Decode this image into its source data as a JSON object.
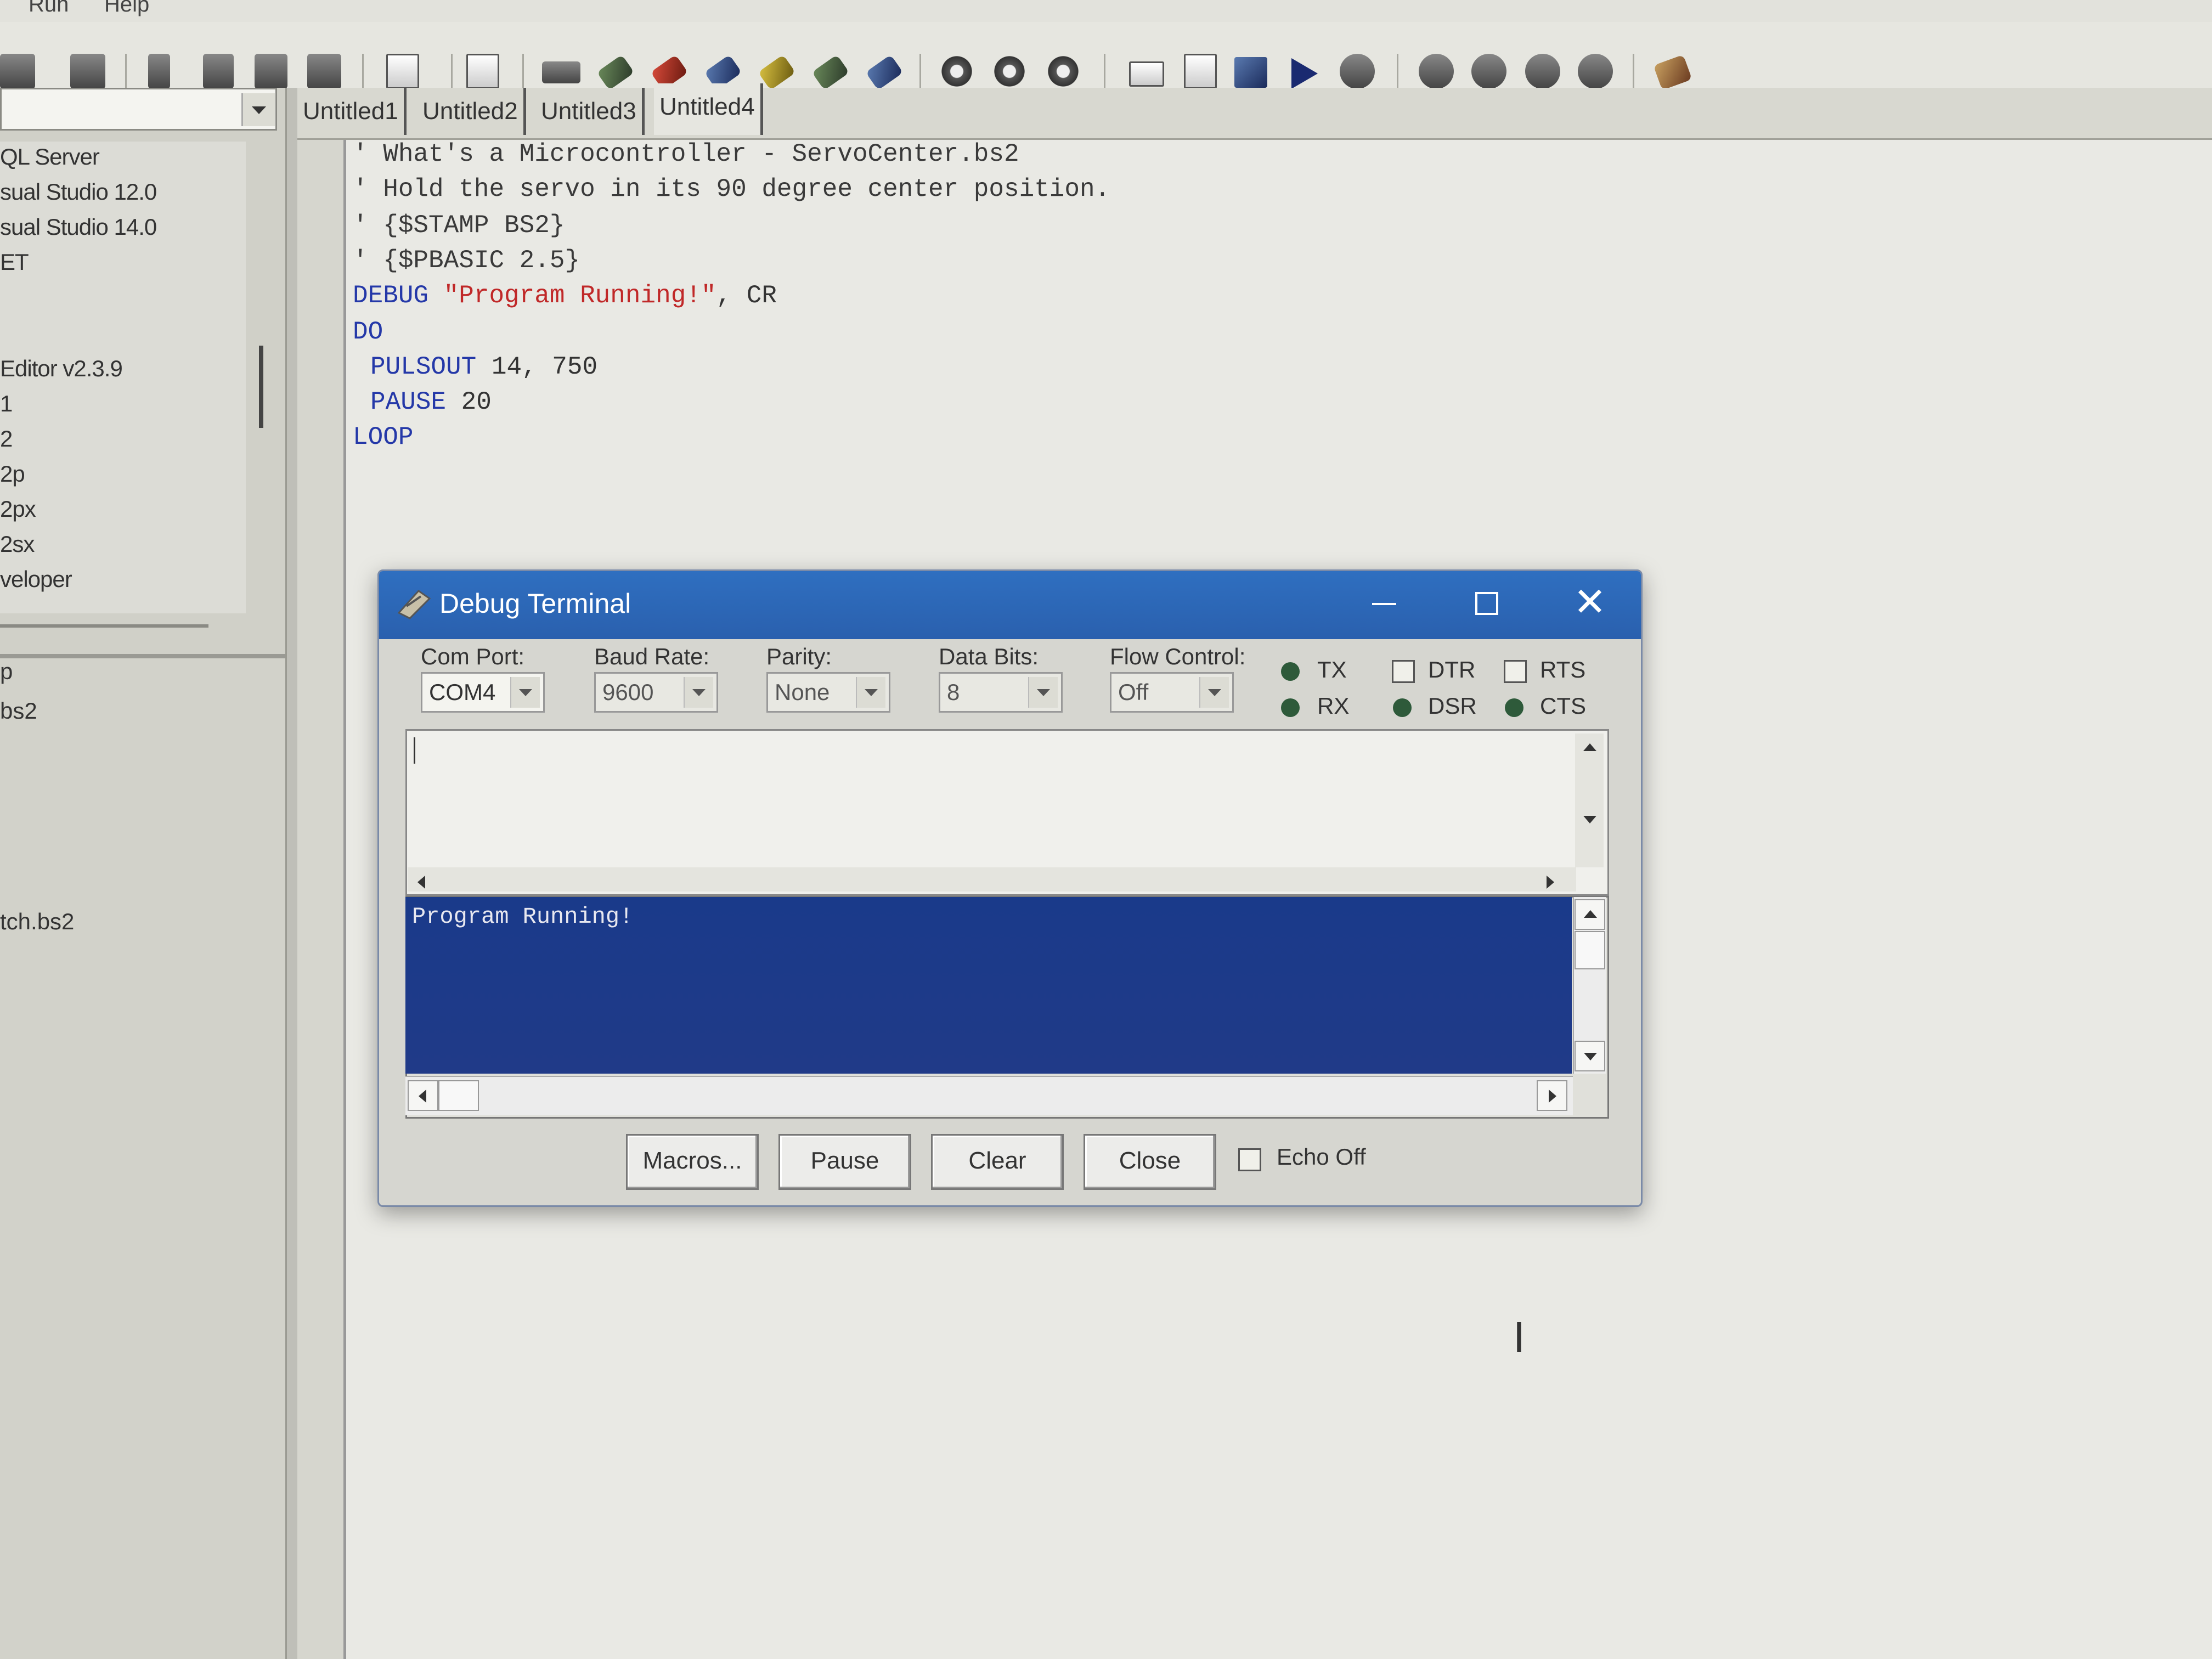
{
  "menu": {
    "items": [
      "Run",
      "Help"
    ]
  },
  "toolbar": {
    "icons": [
      "find-icon",
      "print-icon",
      "cut-icon",
      "copy-icon",
      "paste-icon",
      "binoculars-icon",
      "format-icon",
      "preferences-icon",
      "chip-bs1-icon",
      "chip-bs2-icon",
      "chip-bs2e-icon",
      "chip-bs2sx-icon",
      "chip-bs2p-icon",
      "chip-bs2pe-icon",
      "chip-bs2px-icon",
      "pbasic-1-0-icon",
      "pbasic-2-0-icon",
      "pbasic-2-5-icon",
      "memory-map-icon",
      "check-syntax-icon",
      "run-icon",
      "play-icon",
      "identify-icon",
      "debug-icon",
      "debug-terminal-icon",
      "help-icon",
      "stamp-icon"
    ]
  },
  "explorer": {
    "drive": "",
    "folders": [
      "QL Server",
      "sual Studio 12.0",
      "sual Studio 14.0",
      "ET",
      "Editor v2.3.9",
      "1",
      "2",
      "2p",
      "2px",
      "2sx",
      "veloper"
    ],
    "files": [
      "p",
      "bs2",
      "tch.bs2"
    ]
  },
  "tabs": [
    "Untitled1",
    "Untitled2",
    "Untitled3",
    "Untitled4"
  ],
  "active_tab": "Untitled4",
  "code": {
    "line1": "' What's a Microcontroller - ServoCenter.bs2",
    "line2": "' Hold the servo in its 90 degree center position.",
    "line3": "' {$STAMP BS2}",
    "line4": "' {$PBASIC 2.5}",
    "line5_kw": "DEBUG",
    "line5_str": "\"Program Running!\"",
    "line5_rest": ", CR",
    "line6": "DO",
    "line7_kw": "PULSOUT",
    "line7_rest": " 14, 750",
    "line8_kw": "PAUSE",
    "line8_rest": " 20",
    "line9": "LOOP"
  },
  "debug": {
    "title": "Debug Terminal",
    "close_symbol": "✕",
    "com_port_label": "Com Port:",
    "com_port_value": "COM4",
    "baud_label": "Baud Rate:",
    "baud_value": "9600",
    "parity_label": "Parity:",
    "parity_value": "None",
    "databits_label": "Data Bits:",
    "databits_value": "8",
    "flow_label": "Flow Control:",
    "flow_value": "Off",
    "tx_label": "TX",
    "rx_label": "RX",
    "dtr_label": "DTR",
    "dsr_label": "DSR",
    "rts_label": "RTS",
    "cts_label": "CTS",
    "transmit_text": "",
    "receive_text": "Program Running!",
    "buttons": {
      "macros": "Macros...",
      "pause": "Pause",
      "clear": "Clear",
      "close": "Close"
    },
    "echo_label": "Echo Off"
  }
}
